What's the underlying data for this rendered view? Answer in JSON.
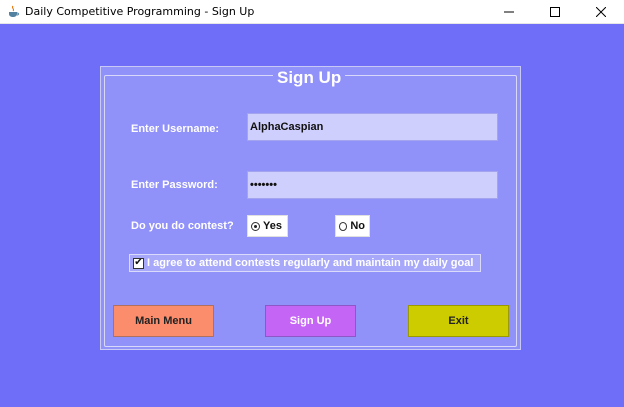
{
  "window": {
    "title": "Daily Competitive Programming - Sign Up",
    "icon": "java-cup-icon"
  },
  "form": {
    "title": "Sign Up",
    "username_label": "Enter Username:",
    "username_value": "AlphaCaspian",
    "password_label": "Enter Password:",
    "password_value": "•••••••",
    "contest_label": "Do you do contest?",
    "radio_yes_label": "Yes",
    "radio_no_label": "No",
    "selected_contest": "Yes",
    "agree_label": "I agree to attend contests regularly and maintain my daily goal",
    "agree_checked": true
  },
  "buttons": {
    "main_menu": "Main Menu",
    "sign_up": "Sign Up",
    "exit": "Exit"
  },
  "colors": {
    "background": "#6e6ef8",
    "panel": "#9191fa",
    "main_menu_button": "#fb8c6c",
    "sign_up_button": "#c565f6",
    "exit_button": "#cccc00"
  }
}
